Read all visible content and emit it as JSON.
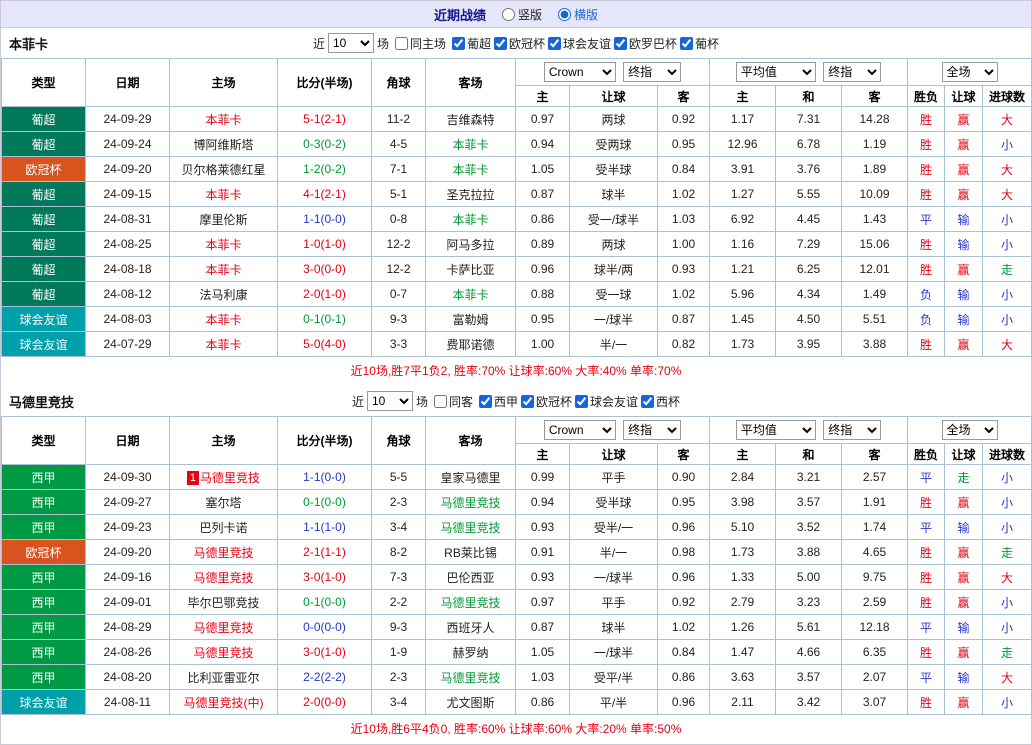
{
  "page": {
    "title": "近期战绩",
    "view_options": [
      {
        "label": "竖版",
        "selected": false
      },
      {
        "label": "横版",
        "selected": true
      }
    ]
  },
  "palette": {
    "topbar_bg": "#e6e6fa",
    "title_color": "#14148e",
    "table_border": "#a9c2d5",
    "red": "#e60012",
    "blue": "#2836c8",
    "green": "#009933",
    "accent": "#1766d9"
  },
  "league_colors": {
    "葡超": "#00795a",
    "欧冠杯": "#d9531e",
    "球会友谊": "#00a0aa",
    "西甲": "#009a44"
  },
  "table_headers": {
    "type": "类型",
    "date": "日期",
    "home": "主场",
    "score": "比分(半场)",
    "corner": "角球",
    "away": "客场",
    "asian": {
      "home": "主",
      "line": "让球",
      "away": "客"
    },
    "euro": {
      "home": "主",
      "draw": "和",
      "away": "客"
    },
    "result": {
      "wdl": "胜负",
      "handicap": "让球",
      "goals": "进球数"
    },
    "selects": {
      "bookmaker": "Crown",
      "final1": "终指",
      "average": "平均值",
      "final2": "终指",
      "fulltime": "全场"
    }
  },
  "sections": [
    {
      "team": "本菲卡",
      "filter": {
        "recent_label": "近",
        "count": "10",
        "games_label": "场",
        "venue_label": "同主场",
        "venue_checked": false,
        "leagues": [
          {
            "label": "葡超",
            "checked": true
          },
          {
            "label": "欧冠杯",
            "checked": true
          },
          {
            "label": "球会友谊",
            "checked": true
          },
          {
            "label": "欧罗巴杯",
            "checked": true
          },
          {
            "label": "葡杯",
            "checked": true
          }
        ]
      },
      "summary": "近10场,胜7平1负2, 胜率:70% 让球率:60% 大率:40% 单率:70%",
      "rows": [
        {
          "league": "葡超",
          "date": "24-09-29",
          "home": "本菲卡",
          "focal": "home",
          "score": "5-1(2-1)",
          "score_color": "red",
          "corners": "11-2",
          "away": "吉维森特",
          "ah_home": "0.97",
          "ah_line": "两球",
          "ah_away": "0.92",
          "eu_home": "1.17",
          "eu_draw": "7.31",
          "eu_away": "14.28",
          "result": "胜",
          "handicap": "赢",
          "goals": "大"
        },
        {
          "league": "葡超",
          "date": "24-09-24",
          "home": "博阿维斯塔",
          "focal": "away",
          "score": "0-3(0-2)",
          "score_color": "green",
          "corners": "4-5",
          "away": "本菲卡",
          "ah_home": "0.94",
          "ah_line": "受两球",
          "ah_away": "0.95",
          "eu_home": "12.96",
          "eu_draw": "6.78",
          "eu_away": "1.19",
          "result": "胜",
          "handicap": "赢",
          "goals": "小"
        },
        {
          "league": "欧冠杯",
          "date": "24-09-20",
          "home": "贝尔格莱德红星",
          "focal": "away",
          "score": "1-2(0-2)",
          "score_color": "green",
          "corners": "7-1",
          "away": "本菲卡",
          "ah_home": "1.05",
          "ah_line": "受半球",
          "ah_away": "0.84",
          "eu_home": "3.91",
          "eu_draw": "3.76",
          "eu_away": "1.89",
          "result": "胜",
          "handicap": "赢",
          "goals": "大"
        },
        {
          "league": "葡超",
          "date": "24-09-15",
          "home": "本菲卡",
          "focal": "home",
          "score": "4-1(2-1)",
          "score_color": "red",
          "corners": "5-1",
          "away": "圣克拉拉",
          "ah_home": "0.87",
          "ah_line": "球半",
          "ah_away": "1.02",
          "eu_home": "1.27",
          "eu_draw": "5.55",
          "eu_away": "10.09",
          "result": "胜",
          "handicap": "赢",
          "goals": "大"
        },
        {
          "league": "葡超",
          "date": "24-08-31",
          "home": "摩里伦斯",
          "focal": "away",
          "score": "1-1(0-0)",
          "score_color": "blue",
          "corners": "0-8",
          "away": "本菲卡",
          "ah_home": "0.86",
          "ah_line": "受一/球半",
          "ah_away": "1.03",
          "eu_home": "6.92",
          "eu_draw": "4.45",
          "eu_away": "1.43",
          "result": "平",
          "handicap": "输",
          "goals": "小"
        },
        {
          "league": "葡超",
          "date": "24-08-25",
          "home": "本菲卡",
          "focal": "home",
          "score": "1-0(1-0)",
          "score_color": "red",
          "corners": "12-2",
          "away": "阿马多拉",
          "ah_home": "0.89",
          "ah_line": "两球",
          "ah_away": "1.00",
          "eu_home": "1.16",
          "eu_draw": "7.29",
          "eu_away": "15.06",
          "result": "胜",
          "handicap": "输",
          "goals": "小"
        },
        {
          "league": "葡超",
          "date": "24-08-18",
          "home": "本菲卡",
          "focal": "home",
          "score": "3-0(0-0)",
          "score_color": "red",
          "corners": "12-2",
          "away": "卡萨比亚",
          "ah_home": "0.96",
          "ah_line": "球半/两",
          "ah_away": "0.93",
          "eu_home": "1.21",
          "eu_draw": "6.25",
          "eu_away": "12.01",
          "result": "胜",
          "handicap": "赢",
          "goals": "走"
        },
        {
          "league": "葡超",
          "date": "24-08-12",
          "home": "法马利康",
          "focal": "away",
          "score": "2-0(1-0)",
          "score_color": "red",
          "corners": "0-7",
          "away": "本菲卡",
          "ah_home": "0.88",
          "ah_line": "受一球",
          "ah_away": "1.02",
          "eu_home": "5.96",
          "eu_draw": "4.34",
          "eu_away": "1.49",
          "result": "负",
          "handicap": "输",
          "goals": "小"
        },
        {
          "league": "球会友谊",
          "date": "24-08-03",
          "home": "本菲卡",
          "focal": "home",
          "score": "0-1(0-1)",
          "score_color": "green",
          "corners": "9-3",
          "away": "富勒姆",
          "ah_home": "0.95",
          "ah_line": "一/球半",
          "ah_away": "0.87",
          "eu_home": "1.45",
          "eu_draw": "4.50",
          "eu_away": "5.51",
          "result": "负",
          "handicap": "输",
          "goals": "小"
        },
        {
          "league": "球会友谊",
          "date": "24-07-29",
          "home": "本菲卡",
          "focal": "home",
          "score": "5-0(4-0)",
          "score_color": "red",
          "corners": "3-3",
          "away": "费耶诺德",
          "ah_home": "1.00",
          "ah_line": "半/一",
          "ah_away": "0.82",
          "eu_home": "1.73",
          "eu_draw": "3.95",
          "eu_away": "3.88",
          "result": "胜",
          "handicap": "赢",
          "goals": "大"
        }
      ]
    },
    {
      "team": "马德里竞技",
      "filter": {
        "recent_label": "近",
        "count": "10",
        "games_label": "场",
        "venue_label": "同客",
        "venue_checked": false,
        "leagues": [
          {
            "label": "西甲",
            "checked": true
          },
          {
            "label": "欧冠杯",
            "checked": true
          },
          {
            "label": "球会友谊",
            "checked": true
          },
          {
            "label": "西杯",
            "checked": true
          }
        ]
      },
      "summary": "近10场,胜6平4负0, 胜率:60% 让球率:60% 大率:20% 单率:50%",
      "rows": [
        {
          "league": "西甲",
          "date": "24-09-30",
          "home": "马德里竞技",
          "home_badge": "1",
          "focal": "home",
          "score": "1-1(0-0)",
          "score_color": "blue",
          "corners": "5-5",
          "away": "皇家马德里",
          "ah_home": "0.99",
          "ah_line": "平手",
          "ah_away": "0.90",
          "eu_home": "2.84",
          "eu_draw": "3.21",
          "eu_away": "2.57",
          "result": "平",
          "handicap": "走",
          "goals": "小"
        },
        {
          "league": "西甲",
          "date": "24-09-27",
          "home": "塞尔塔",
          "focal": "away",
          "score": "0-1(0-0)",
          "score_color": "green",
          "corners": "2-3",
          "away": "马德里竞技",
          "ah_home": "0.94",
          "ah_line": "受半球",
          "ah_away": "0.95",
          "eu_home": "3.98",
          "eu_draw": "3.57",
          "eu_away": "1.91",
          "result": "胜",
          "handicap": "赢",
          "goals": "小"
        },
        {
          "league": "西甲",
          "date": "24-09-23",
          "home": "巴列卡诺",
          "focal": "away",
          "score": "1-1(1-0)",
          "score_color": "blue",
          "corners": "3-4",
          "away": "马德里竞技",
          "ah_home": "0.93",
          "ah_line": "受半/一",
          "ah_away": "0.96",
          "eu_home": "5.10",
          "eu_draw": "3.52",
          "eu_away": "1.74",
          "result": "平",
          "handicap": "输",
          "goals": "小"
        },
        {
          "league": "欧冠杯",
          "date": "24-09-20",
          "home": "马德里竞技",
          "focal": "home",
          "score": "2-1(1-1)",
          "score_color": "red",
          "corners": "8-2",
          "away": "RB莱比锡",
          "ah_home": "0.91",
          "ah_line": "半/一",
          "ah_away": "0.98",
          "eu_home": "1.73",
          "eu_draw": "3.88",
          "eu_away": "4.65",
          "result": "胜",
          "handicap": "赢",
          "goals": "走"
        },
        {
          "league": "西甲",
          "date": "24-09-16",
          "home": "马德里竞技",
          "focal": "home",
          "score": "3-0(1-0)",
          "score_color": "red",
          "corners": "7-3",
          "away": "巴伦西亚",
          "ah_home": "0.93",
          "ah_line": "一/球半",
          "ah_away": "0.96",
          "eu_home": "1.33",
          "eu_draw": "5.00",
          "eu_away": "9.75",
          "result": "胜",
          "handicap": "赢",
          "goals": "大"
        },
        {
          "league": "西甲",
          "date": "24-09-01",
          "home": "毕尔巴鄂竞技",
          "focal": "away",
          "score": "0-1(0-0)",
          "score_color": "green",
          "corners": "2-2",
          "away": "马德里竞技",
          "ah_home": "0.97",
          "ah_line": "平手",
          "ah_away": "0.92",
          "eu_home": "2.79",
          "eu_draw": "3.23",
          "eu_away": "2.59",
          "result": "胜",
          "handicap": "赢",
          "goals": "小"
        },
        {
          "league": "西甲",
          "date": "24-08-29",
          "home": "马德里竞技",
          "focal": "home",
          "score": "0-0(0-0)",
          "score_color": "blue",
          "corners": "9-3",
          "away": "西班牙人",
          "ah_home": "0.87",
          "ah_line": "球半",
          "ah_away": "1.02",
          "eu_home": "1.26",
          "eu_draw": "5.61",
          "eu_away": "12.18",
          "result": "平",
          "handicap": "输",
          "goals": "小"
        },
        {
          "league": "西甲",
          "date": "24-08-26",
          "home": "马德里竞技",
          "focal": "home",
          "score": "3-0(1-0)",
          "score_color": "red",
          "corners": "1-9",
          "away": "赫罗纳",
          "ah_home": "1.05",
          "ah_line": "一/球半",
          "ah_away": "0.84",
          "eu_home": "1.47",
          "eu_draw": "4.66",
          "eu_away": "6.35",
          "result": "胜",
          "handicap": "赢",
          "goals": "走"
        },
        {
          "league": "西甲",
          "date": "24-08-20",
          "home": "比利亚雷亚尔",
          "focal": "away",
          "score": "2-2(2-2)",
          "score_color": "blue",
          "corners": "2-3",
          "away": "马德里竞技",
          "ah_home": "1.03",
          "ah_line": "受平/半",
          "ah_away": "0.86",
          "eu_home": "3.63",
          "eu_draw": "3.57",
          "eu_away": "2.07",
          "result": "平",
          "handicap": "输",
          "goals": "大"
        },
        {
          "league": "球会友谊",
          "date": "24-08-11",
          "home": "马德里竞技(中)",
          "focal": "home",
          "score": "2-0(0-0)",
          "score_color": "red",
          "corners": "3-4",
          "away": "尤文图斯",
          "ah_home": "0.86",
          "ah_line": "平/半",
          "ah_away": "0.96",
          "eu_home": "2.11",
          "eu_draw": "3.42",
          "eu_away": "3.07",
          "result": "胜",
          "handicap": "赢",
          "goals": "小"
        }
      ]
    }
  ]
}
